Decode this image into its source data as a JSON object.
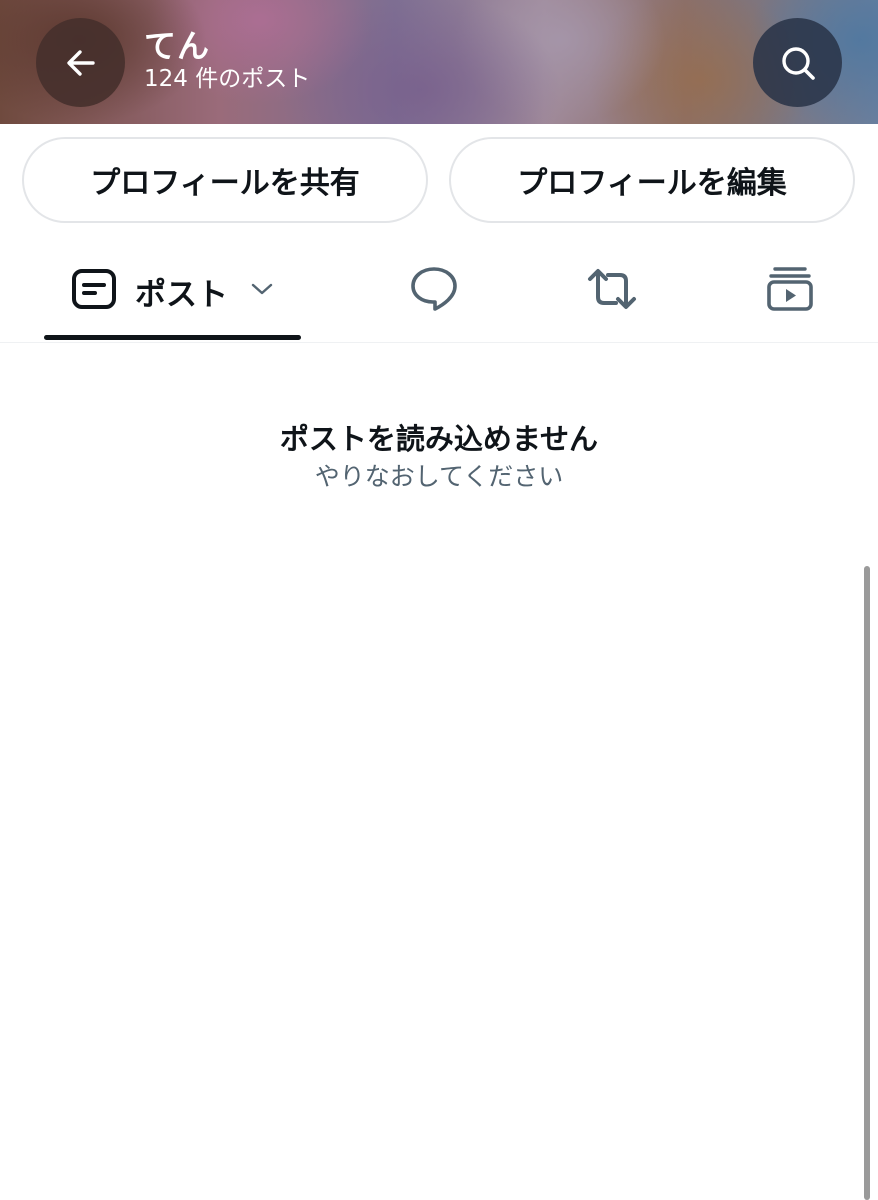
{
  "header": {
    "profile_name": "てん",
    "post_count": "124 件のポスト"
  },
  "icons": {
    "back": "arrow-left-icon",
    "search": "search-icon",
    "posts_tab": "post-list-icon",
    "replies_tab": "speech-bubble-icon",
    "reposts_tab": "repost-icon",
    "videos_tab": "video-play-icon",
    "dropdown": "chevron-down-icon"
  },
  "actions": {
    "share_label": "プロフィールを共有",
    "edit_label": "プロフィールを編集"
  },
  "tabs": {
    "posts_label": "ポスト"
  },
  "empty_state": {
    "title": "ポストを読み込めません",
    "subtitle": "やりなおしてください"
  },
  "colors": {
    "text_primary": "#0f1419",
    "text_secondary": "#536471",
    "border": "#e3e5e8"
  }
}
